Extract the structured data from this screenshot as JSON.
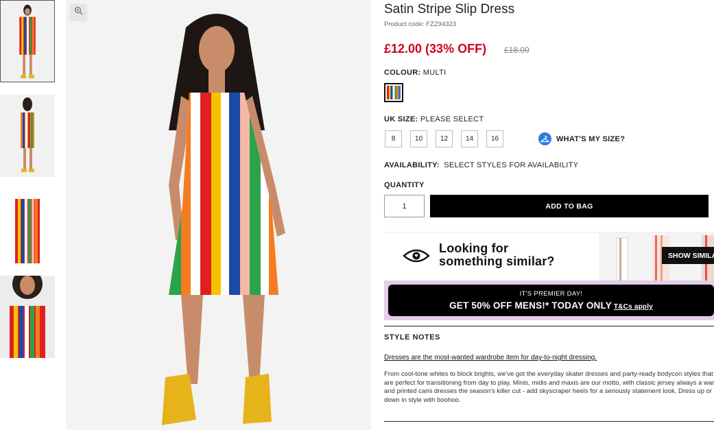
{
  "product": {
    "title": "Satin Stripe Slip Dress",
    "code": "Product code: FZZ94323",
    "price": "£12.00 (33% OFF)",
    "was_price": "£18.00"
  },
  "colour": {
    "label": "COLOUR:",
    "value": "MULTI"
  },
  "size": {
    "label": "UK SIZE:",
    "value": "PLEASE SELECT",
    "options": [
      "8",
      "10",
      "12",
      "14",
      "16"
    ],
    "whats_my_size": "WHAT'S MY SIZE?"
  },
  "availability": {
    "label": "AVAILABILITY:",
    "value": "SELECT STYLES FOR AVAILABILITY"
  },
  "quantity": {
    "label": "QUANTITY",
    "value": "1"
  },
  "add_to_bag": "ADD TO BAG",
  "similar": {
    "line1": "Looking for",
    "line2": "something similar?",
    "button": "SHOW SIMILAR"
  },
  "promo": {
    "line1": "IT'S PREMIER DAY!",
    "line2": "GET 50% OFF MENS!* TODAY ONLY",
    "tcs": "T&Cs apply"
  },
  "style_notes": {
    "heading": "STYLE NOTES",
    "link": "Dresses are the most-wanted wardrobe item for day-to-night dressing.",
    "body_lines": [
      "From cool-tone whites to block brights, we've got the everyday skater dresses and party-ready bodycon styles that",
      "are perfect for transitioning from day to play. Minis, midis and maxis are our motto, with classic jersey always a wardrobe fave,",
      "and printed cami dresses the season's killer cut - add skyscraper heels for a seriously statement look. Dress up or",
      "down in style with boohoo."
    ]
  },
  "colors": {
    "price_red": "#d0021b",
    "promo_bg": "#e4cdea",
    "size_icon_blue": "#2b7de0"
  }
}
